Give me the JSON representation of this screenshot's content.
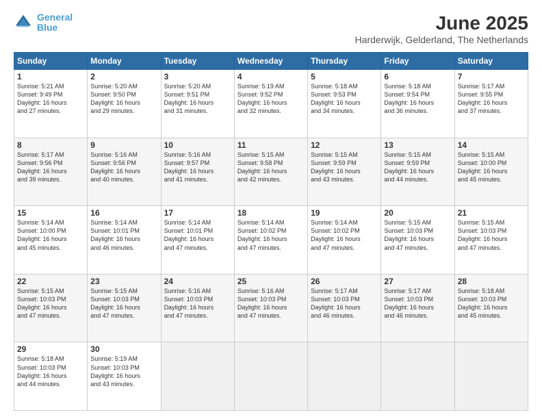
{
  "logo": {
    "line1": "General",
    "line2": "Blue"
  },
  "title": "June 2025",
  "subtitle": "Harderwijk, Gelderland, The Netherlands",
  "weekdays": [
    "Sunday",
    "Monday",
    "Tuesday",
    "Wednesday",
    "Thursday",
    "Friday",
    "Saturday"
  ],
  "weeks": [
    [
      {
        "day": "1",
        "info": "Sunrise: 5:21 AM\nSunset: 9:49 PM\nDaylight: 16 hours\nand 27 minutes."
      },
      {
        "day": "2",
        "info": "Sunrise: 5:20 AM\nSunset: 9:50 PM\nDaylight: 16 hours\nand 29 minutes."
      },
      {
        "day": "3",
        "info": "Sunrise: 5:20 AM\nSunset: 9:51 PM\nDaylight: 16 hours\nand 31 minutes."
      },
      {
        "day": "4",
        "info": "Sunrise: 5:19 AM\nSunset: 9:52 PM\nDaylight: 16 hours\nand 32 minutes."
      },
      {
        "day": "5",
        "info": "Sunrise: 5:18 AM\nSunset: 9:53 PM\nDaylight: 16 hours\nand 34 minutes."
      },
      {
        "day": "6",
        "info": "Sunrise: 5:18 AM\nSunset: 9:54 PM\nDaylight: 16 hours\nand 36 minutes."
      },
      {
        "day": "7",
        "info": "Sunrise: 5:17 AM\nSunset: 9:55 PM\nDaylight: 16 hours\nand 37 minutes."
      }
    ],
    [
      {
        "day": "8",
        "info": "Sunrise: 5:17 AM\nSunset: 9:56 PM\nDaylight: 16 hours\nand 39 minutes."
      },
      {
        "day": "9",
        "info": "Sunrise: 5:16 AM\nSunset: 9:56 PM\nDaylight: 16 hours\nand 40 minutes."
      },
      {
        "day": "10",
        "info": "Sunrise: 5:16 AM\nSunset: 9:57 PM\nDaylight: 16 hours\nand 41 minutes."
      },
      {
        "day": "11",
        "info": "Sunrise: 5:15 AM\nSunset: 9:58 PM\nDaylight: 16 hours\nand 42 minutes."
      },
      {
        "day": "12",
        "info": "Sunrise: 5:15 AM\nSunset: 9:59 PM\nDaylight: 16 hours\nand 43 minutes."
      },
      {
        "day": "13",
        "info": "Sunrise: 5:15 AM\nSunset: 9:59 PM\nDaylight: 16 hours\nand 44 minutes."
      },
      {
        "day": "14",
        "info": "Sunrise: 5:15 AM\nSunset: 10:00 PM\nDaylight: 16 hours\nand 45 minutes."
      }
    ],
    [
      {
        "day": "15",
        "info": "Sunrise: 5:14 AM\nSunset: 10:00 PM\nDaylight: 16 hours\nand 45 minutes."
      },
      {
        "day": "16",
        "info": "Sunrise: 5:14 AM\nSunset: 10:01 PM\nDaylight: 16 hours\nand 46 minutes."
      },
      {
        "day": "17",
        "info": "Sunrise: 5:14 AM\nSunset: 10:01 PM\nDaylight: 16 hours\nand 47 minutes."
      },
      {
        "day": "18",
        "info": "Sunrise: 5:14 AM\nSunset: 10:02 PM\nDaylight: 16 hours\nand 47 minutes."
      },
      {
        "day": "19",
        "info": "Sunrise: 5:14 AM\nSunset: 10:02 PM\nDaylight: 16 hours\nand 47 minutes."
      },
      {
        "day": "20",
        "info": "Sunrise: 5:15 AM\nSunset: 10:03 PM\nDaylight: 16 hours\nand 47 minutes."
      },
      {
        "day": "21",
        "info": "Sunrise: 5:15 AM\nSunset: 10:03 PM\nDaylight: 16 hours\nand 47 minutes."
      }
    ],
    [
      {
        "day": "22",
        "info": "Sunrise: 5:15 AM\nSunset: 10:03 PM\nDaylight: 16 hours\nand 47 minutes."
      },
      {
        "day": "23",
        "info": "Sunrise: 5:15 AM\nSunset: 10:03 PM\nDaylight: 16 hours\nand 47 minutes."
      },
      {
        "day": "24",
        "info": "Sunrise: 5:16 AM\nSunset: 10:03 PM\nDaylight: 16 hours\nand 47 minutes."
      },
      {
        "day": "25",
        "info": "Sunrise: 5:16 AM\nSunset: 10:03 PM\nDaylight: 16 hours\nand 47 minutes."
      },
      {
        "day": "26",
        "info": "Sunrise: 5:17 AM\nSunset: 10:03 PM\nDaylight: 16 hours\nand 46 minutes."
      },
      {
        "day": "27",
        "info": "Sunrise: 5:17 AM\nSunset: 10:03 PM\nDaylight: 16 hours\nand 46 minutes."
      },
      {
        "day": "28",
        "info": "Sunrise: 5:18 AM\nSunset: 10:03 PM\nDaylight: 16 hours\nand 45 minutes."
      }
    ],
    [
      {
        "day": "29",
        "info": "Sunrise: 5:18 AM\nSunset: 10:03 PM\nDaylight: 16 hours\nand 44 minutes."
      },
      {
        "day": "30",
        "info": "Sunrise: 5:19 AM\nSunset: 10:03 PM\nDaylight: 16 hours\nand 43 minutes."
      },
      {
        "day": "",
        "info": ""
      },
      {
        "day": "",
        "info": ""
      },
      {
        "day": "",
        "info": ""
      },
      {
        "day": "",
        "info": ""
      },
      {
        "day": "",
        "info": ""
      }
    ]
  ]
}
